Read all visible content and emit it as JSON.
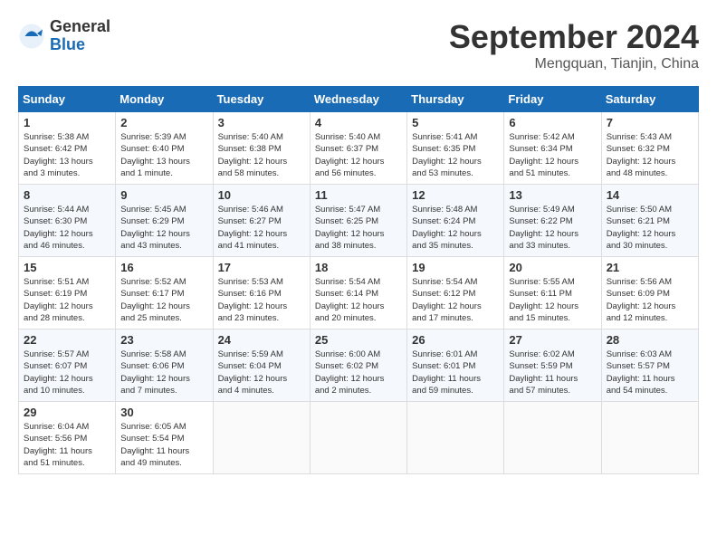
{
  "header": {
    "logo_general": "General",
    "logo_blue": "Blue",
    "month_year": "September 2024",
    "location": "Mengquan, Tianjin, China"
  },
  "weekdays": [
    "Sunday",
    "Monday",
    "Tuesday",
    "Wednesday",
    "Thursday",
    "Friday",
    "Saturday"
  ],
  "weeks": [
    [
      {
        "day": "1",
        "info": "Sunrise: 5:38 AM\nSunset: 6:42 PM\nDaylight: 13 hours\nand 3 minutes."
      },
      {
        "day": "2",
        "info": "Sunrise: 5:39 AM\nSunset: 6:40 PM\nDaylight: 13 hours\nand 1 minute."
      },
      {
        "day": "3",
        "info": "Sunrise: 5:40 AM\nSunset: 6:38 PM\nDaylight: 12 hours\nand 58 minutes."
      },
      {
        "day": "4",
        "info": "Sunrise: 5:40 AM\nSunset: 6:37 PM\nDaylight: 12 hours\nand 56 minutes."
      },
      {
        "day": "5",
        "info": "Sunrise: 5:41 AM\nSunset: 6:35 PM\nDaylight: 12 hours\nand 53 minutes."
      },
      {
        "day": "6",
        "info": "Sunrise: 5:42 AM\nSunset: 6:34 PM\nDaylight: 12 hours\nand 51 minutes."
      },
      {
        "day": "7",
        "info": "Sunrise: 5:43 AM\nSunset: 6:32 PM\nDaylight: 12 hours\nand 48 minutes."
      }
    ],
    [
      {
        "day": "8",
        "info": "Sunrise: 5:44 AM\nSunset: 6:30 PM\nDaylight: 12 hours\nand 46 minutes."
      },
      {
        "day": "9",
        "info": "Sunrise: 5:45 AM\nSunset: 6:29 PM\nDaylight: 12 hours\nand 43 minutes."
      },
      {
        "day": "10",
        "info": "Sunrise: 5:46 AM\nSunset: 6:27 PM\nDaylight: 12 hours\nand 41 minutes."
      },
      {
        "day": "11",
        "info": "Sunrise: 5:47 AM\nSunset: 6:25 PM\nDaylight: 12 hours\nand 38 minutes."
      },
      {
        "day": "12",
        "info": "Sunrise: 5:48 AM\nSunset: 6:24 PM\nDaylight: 12 hours\nand 35 minutes."
      },
      {
        "day": "13",
        "info": "Sunrise: 5:49 AM\nSunset: 6:22 PM\nDaylight: 12 hours\nand 33 minutes."
      },
      {
        "day": "14",
        "info": "Sunrise: 5:50 AM\nSunset: 6:21 PM\nDaylight: 12 hours\nand 30 minutes."
      }
    ],
    [
      {
        "day": "15",
        "info": "Sunrise: 5:51 AM\nSunset: 6:19 PM\nDaylight: 12 hours\nand 28 minutes."
      },
      {
        "day": "16",
        "info": "Sunrise: 5:52 AM\nSunset: 6:17 PM\nDaylight: 12 hours\nand 25 minutes."
      },
      {
        "day": "17",
        "info": "Sunrise: 5:53 AM\nSunset: 6:16 PM\nDaylight: 12 hours\nand 23 minutes."
      },
      {
        "day": "18",
        "info": "Sunrise: 5:54 AM\nSunset: 6:14 PM\nDaylight: 12 hours\nand 20 minutes."
      },
      {
        "day": "19",
        "info": "Sunrise: 5:54 AM\nSunset: 6:12 PM\nDaylight: 12 hours\nand 17 minutes."
      },
      {
        "day": "20",
        "info": "Sunrise: 5:55 AM\nSunset: 6:11 PM\nDaylight: 12 hours\nand 15 minutes."
      },
      {
        "day": "21",
        "info": "Sunrise: 5:56 AM\nSunset: 6:09 PM\nDaylight: 12 hours\nand 12 minutes."
      }
    ],
    [
      {
        "day": "22",
        "info": "Sunrise: 5:57 AM\nSunset: 6:07 PM\nDaylight: 12 hours\nand 10 minutes."
      },
      {
        "day": "23",
        "info": "Sunrise: 5:58 AM\nSunset: 6:06 PM\nDaylight: 12 hours\nand 7 minutes."
      },
      {
        "day": "24",
        "info": "Sunrise: 5:59 AM\nSunset: 6:04 PM\nDaylight: 12 hours\nand 4 minutes."
      },
      {
        "day": "25",
        "info": "Sunrise: 6:00 AM\nSunset: 6:02 PM\nDaylight: 12 hours\nand 2 minutes."
      },
      {
        "day": "26",
        "info": "Sunrise: 6:01 AM\nSunset: 6:01 PM\nDaylight: 11 hours\nand 59 minutes."
      },
      {
        "day": "27",
        "info": "Sunrise: 6:02 AM\nSunset: 5:59 PM\nDaylight: 11 hours\nand 57 minutes."
      },
      {
        "day": "28",
        "info": "Sunrise: 6:03 AM\nSunset: 5:57 PM\nDaylight: 11 hours\nand 54 minutes."
      }
    ],
    [
      {
        "day": "29",
        "info": "Sunrise: 6:04 AM\nSunset: 5:56 PM\nDaylight: 11 hours\nand 51 minutes."
      },
      {
        "day": "30",
        "info": "Sunrise: 6:05 AM\nSunset: 5:54 PM\nDaylight: 11 hours\nand 49 minutes."
      },
      null,
      null,
      null,
      null,
      null
    ]
  ]
}
